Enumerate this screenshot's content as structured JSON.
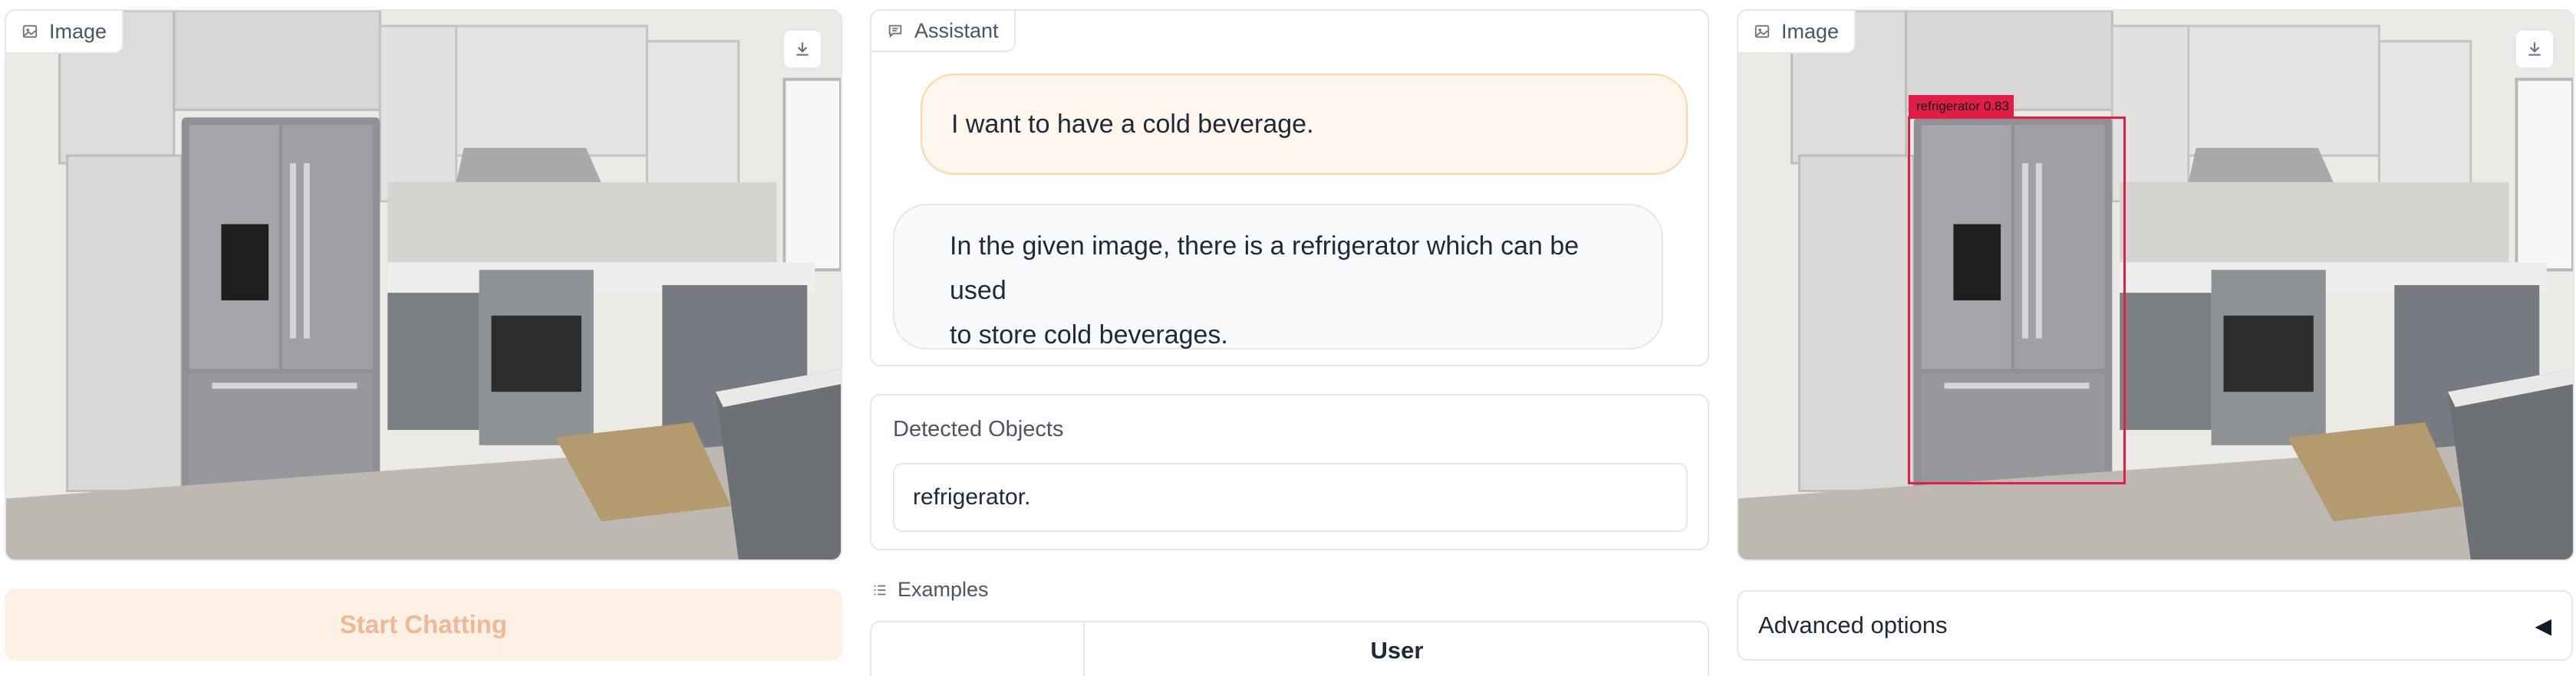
{
  "input_image": {
    "label": "Image"
  },
  "start_button": {
    "label": "Start Chatting"
  },
  "chat": {
    "label": "Assistant",
    "messages": [
      {
        "role": "user",
        "text": "I want to have a cold beverage."
      },
      {
        "role": "assistant",
        "text_line1": "In the given image, there is a refrigerator which can be used",
        "text_line2": "to store cold beverages."
      }
    ]
  },
  "detected": {
    "label": "Detected Objects",
    "value": "refrigerator."
  },
  "examples": {
    "label": "Examples",
    "column_header": "User"
  },
  "output_image": {
    "label": "Image",
    "detection_label": "refrigerator  0.83"
  },
  "advanced": {
    "label": "Advanced options",
    "toggle_glyph": "◀"
  },
  "icons": [
    "image-icon",
    "download-icon",
    "chat-icon",
    "list-icon"
  ],
  "colors": {
    "accent": "#f97316",
    "detection": "#e11d48",
    "user_bubble": "#fff7ed"
  }
}
